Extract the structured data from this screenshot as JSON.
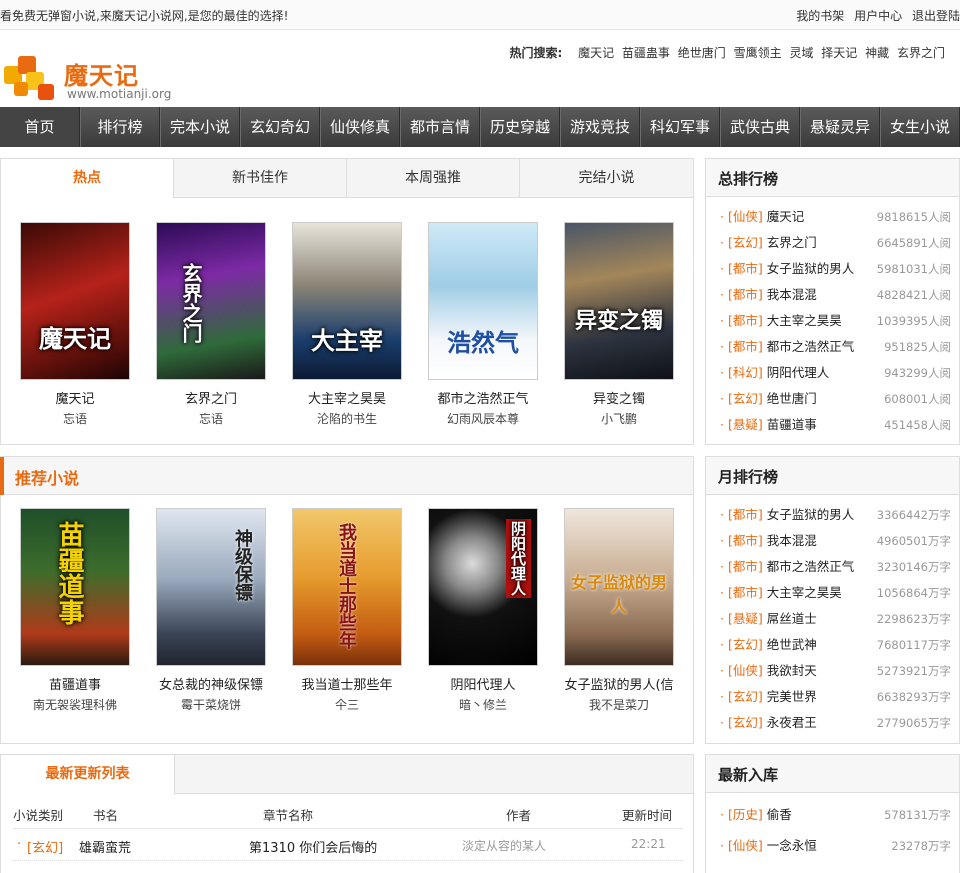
{
  "topbar": {
    "slogan": "看免费无弹窗小说,来魔天记小说网,是您的最佳的选择!",
    "links": [
      "我的书架",
      "用户中心",
      "退出登陆"
    ]
  },
  "logo": {
    "name": "魔天记",
    "url": "www.motianji.org"
  },
  "hot_search": {
    "label": "热门搜索:",
    "items": [
      "魔天记",
      "苗疆蛊事",
      "绝世唐门",
      "雪鹰领主",
      "灵域",
      "择天记",
      "神藏",
      "玄界之门"
    ]
  },
  "nav": [
    "首页",
    "排行榜",
    "完本小说",
    "玄幻奇幻",
    "仙侠修真",
    "都市言情",
    "历史穿越",
    "游戏竞技",
    "科幻军事",
    "武侠古典",
    "悬疑灵异",
    "女生小说"
  ],
  "hot_tabs": [
    "热点",
    "新书佳作",
    "本周强推",
    "完结小说"
  ],
  "hot_books": [
    {
      "title": "魔天记",
      "author": "忘语",
      "cover_text": "魔天记"
    },
    {
      "title": "玄界之门",
      "author": "忘语",
      "cover_text": "玄界之门"
    },
    {
      "title": "大主宰之昊昊",
      "author": "沦陷的书生",
      "cover_text": "大主宰"
    },
    {
      "title": "都市之浩然正气",
      "author": "幻雨风辰本尊",
      "cover_text": "浩然气"
    },
    {
      "title": "异变之镯",
      "author": "小飞鹏",
      "cover_text": "异变之镯"
    }
  ],
  "recommend": {
    "title": "推荐小说",
    "books": [
      {
        "title": "苗疆道事",
        "author": "南无袈裟理科佛",
        "cover_text": "苗疆道事"
      },
      {
        "title": "女总裁的神级保镖",
        "author": "霉干菜烧饼",
        "cover_text": "神级保镖"
      },
      {
        "title": "我当道士那些年",
        "author": "仐三",
        "cover_text": "我当道士那些年"
      },
      {
        "title": "阴阳代理人",
        "author": "暗丶修兰",
        "cover_text": "阴阳代理人"
      },
      {
        "title": "女子监狱的男人(信",
        "author": "我不是菜刀",
        "cover_text": "女子监狱的男人"
      }
    ]
  },
  "total_rank": {
    "title": "总排行榜",
    "items": [
      {
        "cat": "[仙侠]",
        "name": "魔天记",
        "count": "9818615人阅"
      },
      {
        "cat": "[玄幻]",
        "name": "玄界之门",
        "count": "6645891人阅"
      },
      {
        "cat": "[都市]",
        "name": "女子监狱的男人",
        "count": "5981031人阅"
      },
      {
        "cat": "[都市]",
        "name": "我本混混",
        "count": "4828421人阅"
      },
      {
        "cat": "[都市]",
        "name": "大主宰之昊昊",
        "count": "1039395人阅"
      },
      {
        "cat": "[都市]",
        "name": "都市之浩然正气",
        "count": "951825人阅"
      },
      {
        "cat": "[科幻]",
        "name": "阴阳代理人",
        "count": "943299人阅"
      },
      {
        "cat": "[玄幻]",
        "name": "绝世唐门",
        "count": "608001人阅"
      },
      {
        "cat": "[悬疑]",
        "name": "苗疆道事",
        "count": "451458人阅"
      }
    ]
  },
  "month_rank": {
    "title": "月排行榜",
    "items": [
      {
        "cat": "[都市]",
        "name": "女子监狱的男人",
        "count": "3366442万字"
      },
      {
        "cat": "[都市]",
        "name": "我本混混",
        "count": "4960501万字"
      },
      {
        "cat": "[都市]",
        "name": "都市之浩然正气",
        "count": "3230146万字"
      },
      {
        "cat": "[都市]",
        "name": "大主宰之昊昊",
        "count": "1056864万字"
      },
      {
        "cat": "[悬疑]",
        "name": "屌丝道士",
        "count": "2298623万字"
      },
      {
        "cat": "[玄幻]",
        "name": "绝世武神",
        "count": "7680117万字"
      },
      {
        "cat": "[仙侠]",
        "name": "我欲封天",
        "count": "5273921万字"
      },
      {
        "cat": "[玄幻]",
        "name": "完美世界",
        "count": "6638293万字"
      },
      {
        "cat": "[玄幻]",
        "name": "永夜君王",
        "count": "2779065万字"
      }
    ]
  },
  "new_in": {
    "title": "最新入库",
    "items": [
      {
        "cat": "[历史]",
        "name": "偷香",
        "count": "578131万字"
      },
      {
        "cat": "[仙侠]",
        "name": "一念永恒",
        "count": "23278万字"
      }
    ]
  },
  "latest": {
    "title": "最新更新列表",
    "headers": [
      "小说类别",
      "书名",
      "章节名称",
      "作者",
      "更新时间"
    ],
    "rows": [
      {
        "cat": "[玄幻]",
        "name": "雄霸蛮荒",
        "chapter": "第1310 你们会后悔的",
        "author": "淡定从容的某人",
        "time": "22:21"
      }
    ]
  },
  "colors": {
    "accent": "#e86b12",
    "nav_bg": "#4a4a4a"
  }
}
